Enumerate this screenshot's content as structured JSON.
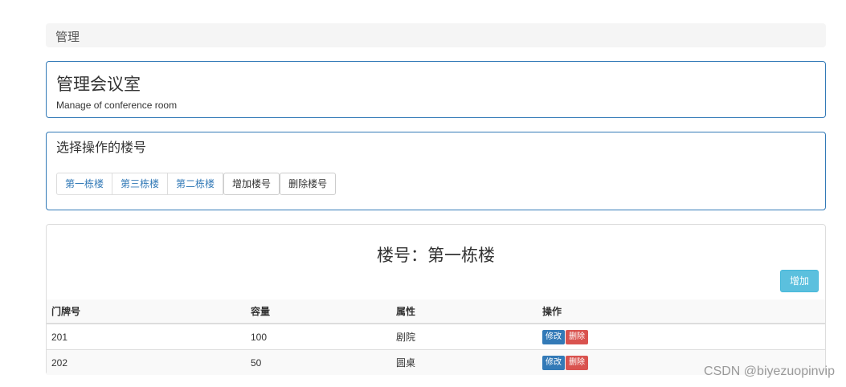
{
  "breadcrumb": {
    "label": "管理"
  },
  "header": {
    "title": "管理会议室",
    "subtitle": "Manage of conference room"
  },
  "building_select": {
    "title": "选择操作的楼号",
    "buildings": [
      {
        "label": "第一栋楼"
      },
      {
        "label": "第三栋楼"
      },
      {
        "label": "第二栋楼"
      }
    ],
    "add_label": "增加楼号",
    "delete_label": "删除楼号"
  },
  "rooms": {
    "title": "楼号：第一栋楼",
    "add_label": "增加",
    "columns": [
      "门牌号",
      "容量",
      "属性",
      "操作"
    ],
    "rows": [
      {
        "number": "201",
        "capacity": "100",
        "type": "剧院",
        "edit_label": "修改",
        "delete_label": "删除"
      },
      {
        "number": "202",
        "capacity": "50",
        "type": "圆桌",
        "edit_label": "修改",
        "delete_label": "删除"
      }
    ]
  },
  "watermark": "CSDN @biyezuopinvip",
  "colors": {
    "primary": "#337ab7",
    "info": "#5bc0de",
    "danger": "#d9534f"
  }
}
